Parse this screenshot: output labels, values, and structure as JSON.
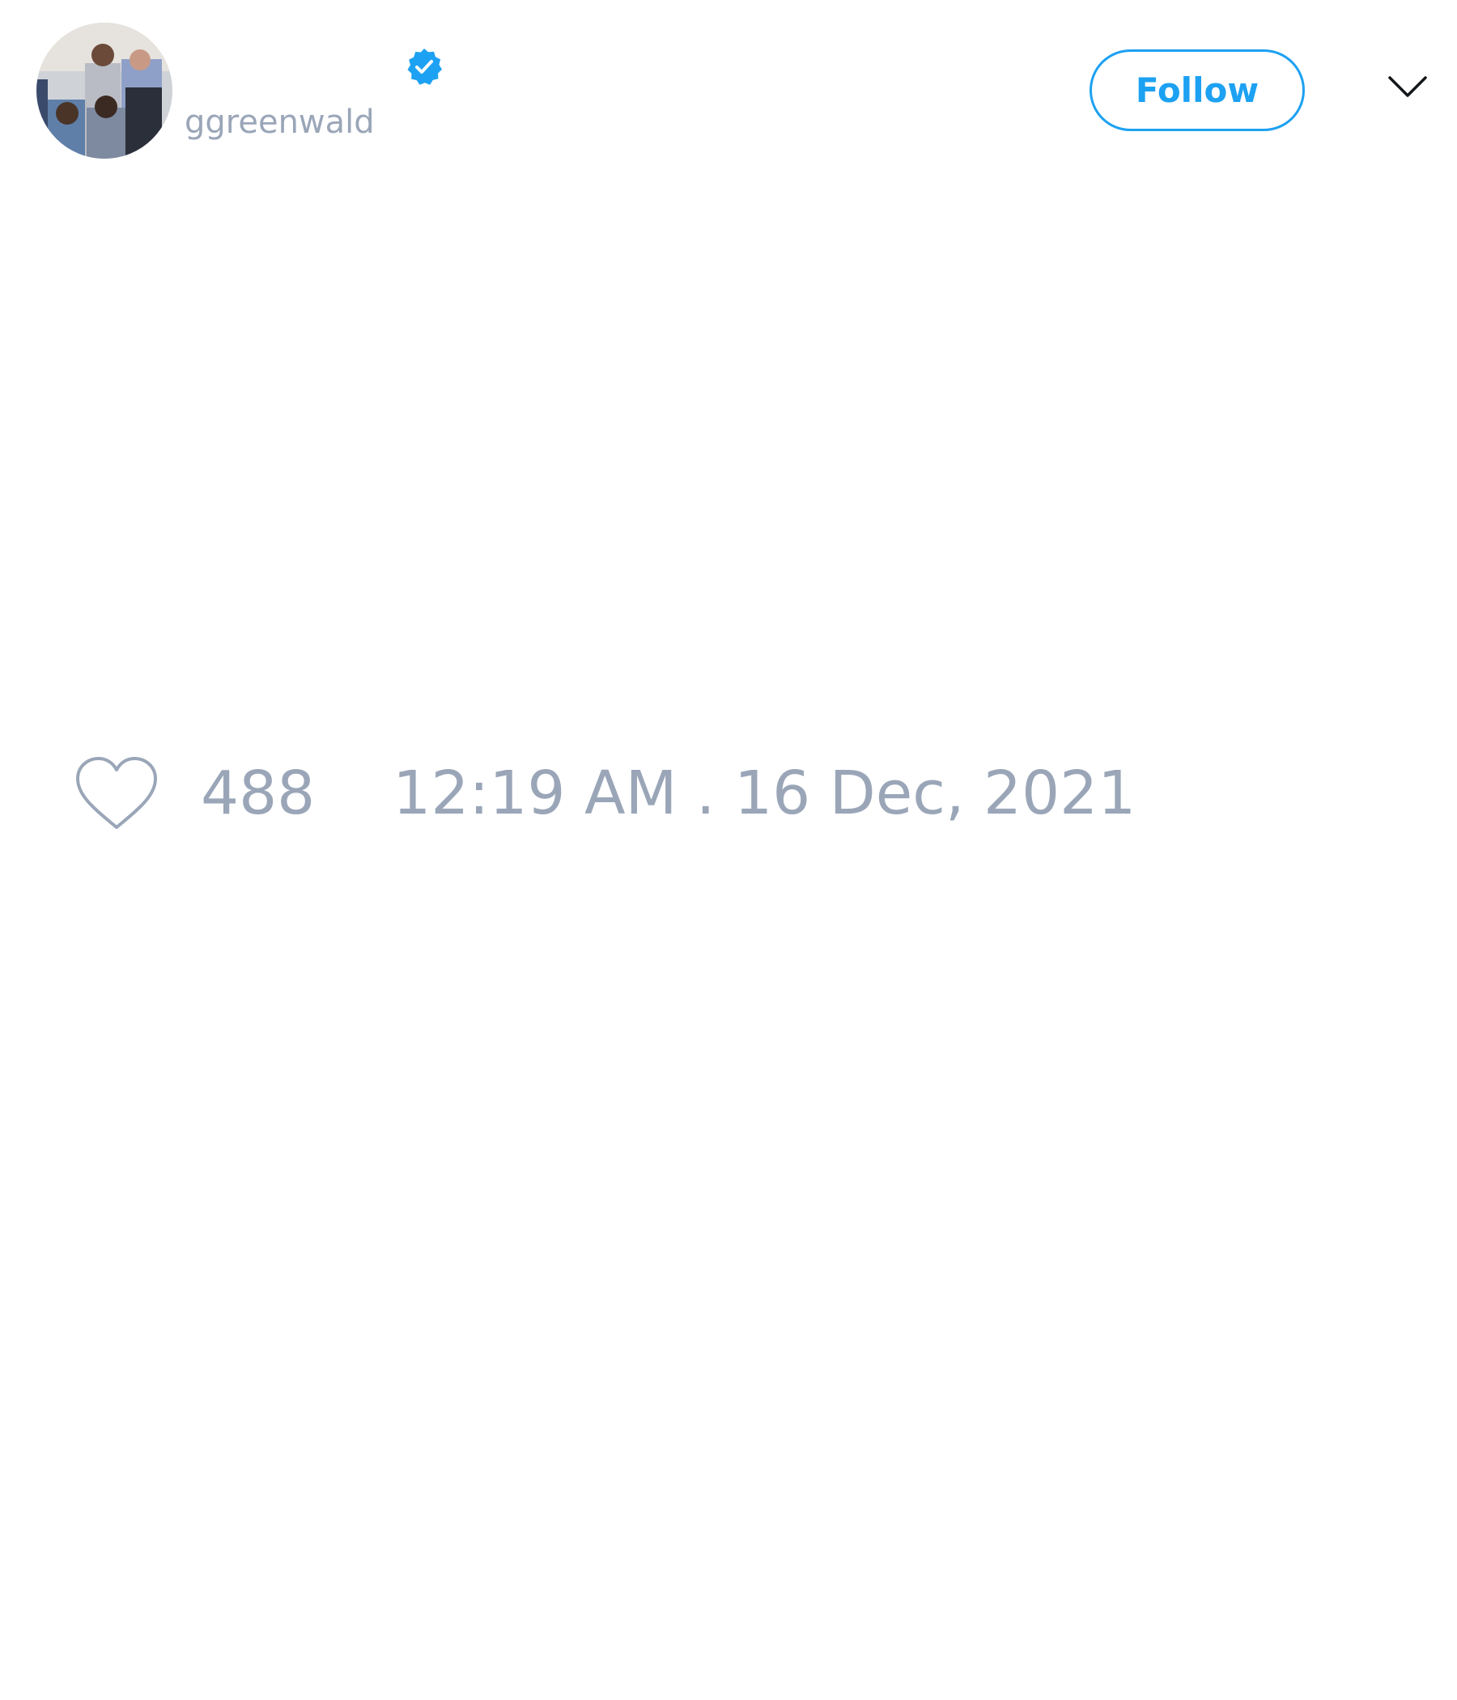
{
  "tweet": {
    "author": {
      "display_name": "",
      "handle": "ggreenwald",
      "verified": true,
      "avatar": "avatar-photo-icon"
    },
    "follow_label": "Follow",
    "menu_icon": "chevron-down-icon",
    "body_text": "",
    "likes": {
      "icon": "heart-icon",
      "count": "488"
    },
    "timestamp": "12:19 AM . 16 Dec, 2021"
  },
  "colors": {
    "accent": "#1da1f2",
    "muted_text": "#9aa6b8",
    "background": "#ffffff"
  }
}
